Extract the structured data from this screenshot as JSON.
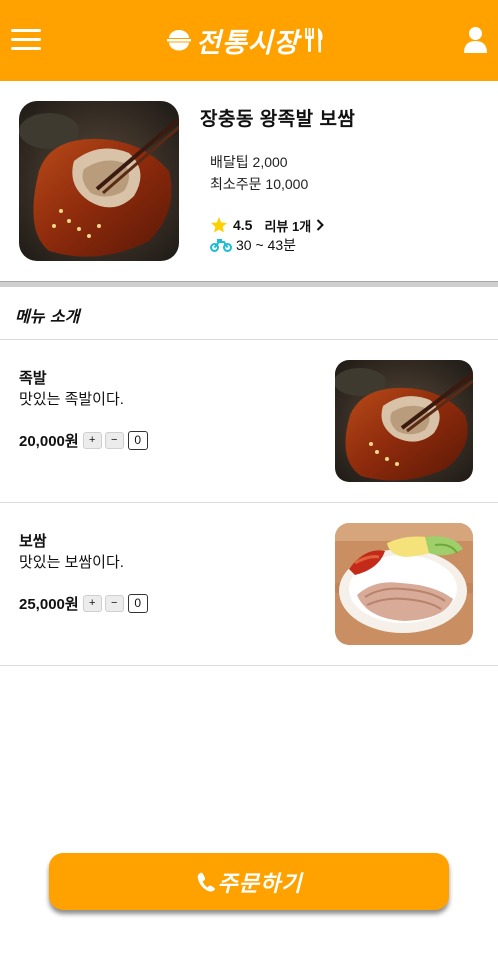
{
  "header": {
    "logo_text": "전통시장",
    "menu_icon": "hamburger-menu-icon",
    "user_icon": "user-icon",
    "brand_color": "#ffa200"
  },
  "store": {
    "name": "장충동 왕족발 보쌈",
    "delivery_fee": "배달팁 2,000",
    "min_order": "최소주문 10,000",
    "rating": "4.5",
    "review_link": "리뷰 1개",
    "delivery_time": "30 ~ 43분"
  },
  "section": {
    "title": "메뉴 소개"
  },
  "menu": [
    {
      "name": "족발",
      "desc": "맛있는 족발이다.",
      "price": "20,000원",
      "plus": "+",
      "minus": "−",
      "qty": "0"
    },
    {
      "name": "보쌈",
      "desc": "맛있는 보쌈이다.",
      "price": "25,000원",
      "plus": "+",
      "minus": "−",
      "qty": "0"
    }
  ],
  "order": {
    "label": "주문하기"
  }
}
